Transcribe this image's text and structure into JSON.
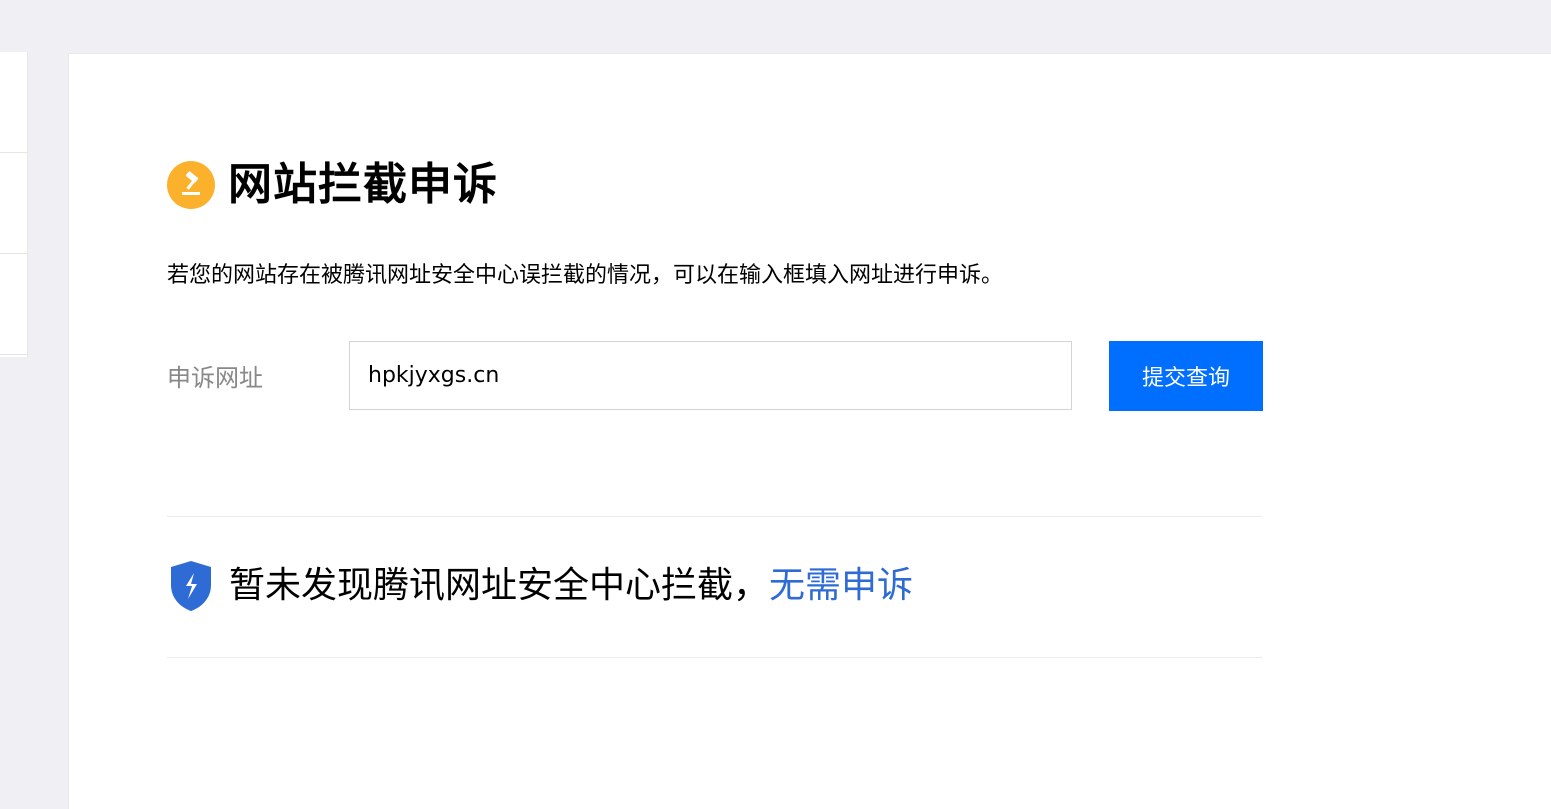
{
  "page": {
    "title": "网站拦截申诉",
    "intro": "若您的网站存在被腾讯网址安全中心误拦截的情况，可以在输入框填入网址进行申诉。"
  },
  "form": {
    "label": "申诉网址",
    "url_value": "hpkjyxgs.cn",
    "submit_label": "提交查询"
  },
  "result": {
    "message": "暂未发现腾讯网址安全中心拦截，",
    "link_text": "无需申诉"
  },
  "icons": {
    "title_icon": "gavel-icon",
    "result_icon": "shield-icon"
  },
  "colors": {
    "accent": "#006eff",
    "link": "#2f6bd5",
    "title_icon_bg": "#fbb12b",
    "shield": "#2f6bd5",
    "background": "#efeff4"
  }
}
